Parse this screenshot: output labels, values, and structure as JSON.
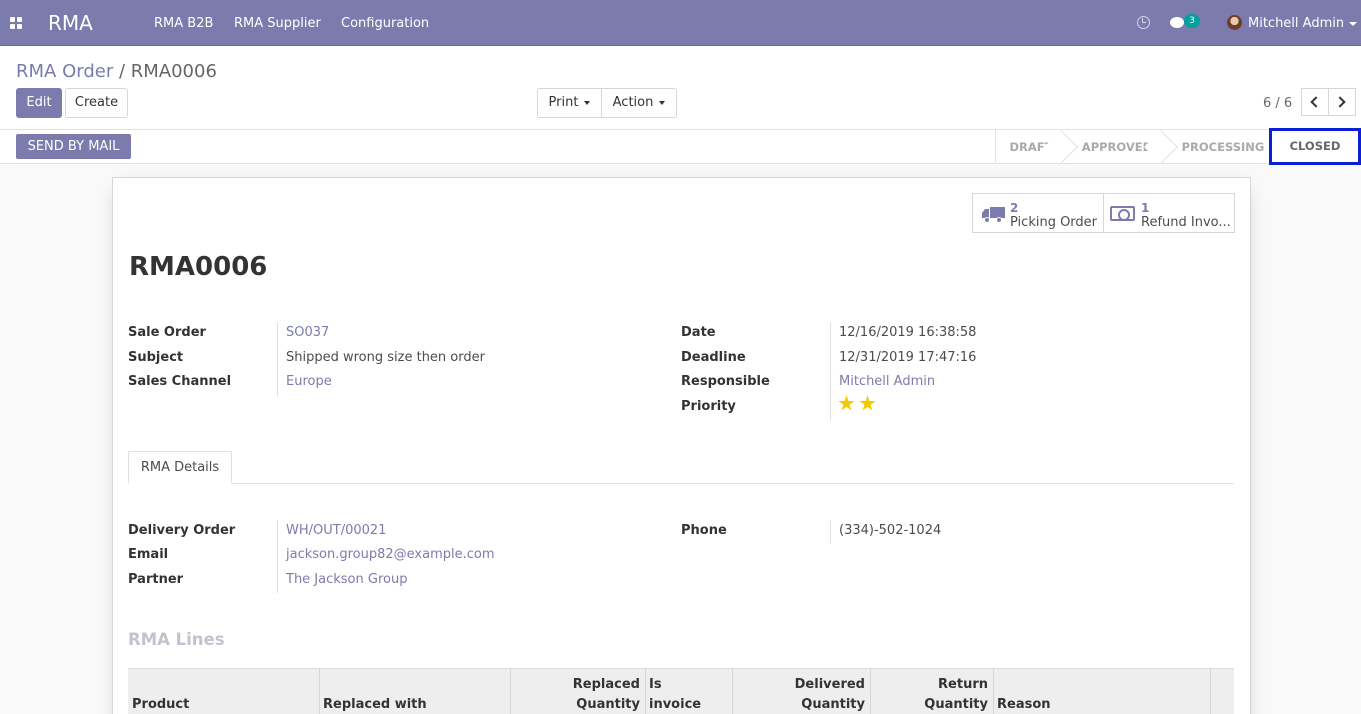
{
  "navbar": {
    "brand": "RMA",
    "menu": [
      "RMA B2B",
      "RMA Supplier",
      "Configuration"
    ],
    "messages_count": "3",
    "user": "Mitchell Admin"
  },
  "breadcrumb": {
    "parent": "RMA Order",
    "separator": " / ",
    "current": "RMA0006"
  },
  "toolbar": {
    "edit": "Edit",
    "create": "Create",
    "print": "Print",
    "action": "Action"
  },
  "pager": {
    "value": "6 / 6"
  },
  "statusbar": {
    "send_by_mail": "SEND BY MAIL",
    "stages": [
      "DRAFT",
      "APPROVED",
      "PROCESSING",
      "CLOSED"
    ],
    "active_stage": "CLOSED"
  },
  "smart_buttons": [
    {
      "count": "2",
      "label": "Picking Order",
      "icon": "truck-icon"
    },
    {
      "count": "1",
      "label": "Refund Invo...",
      "icon": "money-icon"
    }
  ],
  "record": {
    "name": "RMA0006",
    "left": [
      {
        "label": "Sale Order",
        "value": "SO037"
      },
      {
        "label": "Subject",
        "value": "Shipped wrong size then order"
      },
      {
        "label": "Sales Channel",
        "value": "Europe"
      }
    ],
    "right": [
      {
        "label": "Date",
        "value": "12/16/2019 16:38:58"
      },
      {
        "label": "Deadline",
        "value": "12/31/2019 17:47:16"
      },
      {
        "label": "Responsible",
        "value": "Mitchell Admin"
      },
      {
        "label": "Priority",
        "value": ""
      }
    ],
    "priority_stars": 2
  },
  "tabs": [
    "RMA Details"
  ],
  "details": {
    "left": [
      {
        "label": "Delivery Order",
        "value": "WH/OUT/00021"
      },
      {
        "label": "Email",
        "value": "jackson.group82@example.com"
      },
      {
        "label": "Partner",
        "value": "The Jackson Group"
      }
    ],
    "right": [
      {
        "label": "Phone",
        "value": "(334)-502-1024"
      }
    ]
  },
  "lines": {
    "title": "RMA Lines",
    "columns": [
      {
        "line1": "",
        "line2": "Product"
      },
      {
        "line1": "",
        "line2": "Replaced with"
      },
      {
        "line1": "Replaced",
        "line2": "Quantity"
      },
      {
        "line1": "Is",
        "line2": "invoice"
      },
      {
        "line1": "Delivered",
        "line2": "Quantity"
      },
      {
        "line1": "Return",
        "line2": "Quantity"
      },
      {
        "line1": "",
        "line2": "Reason"
      }
    ]
  },
  "colors": {
    "brand": "#7c7bad",
    "highlight": "#0a1fd6",
    "star": "#f3cc00"
  }
}
